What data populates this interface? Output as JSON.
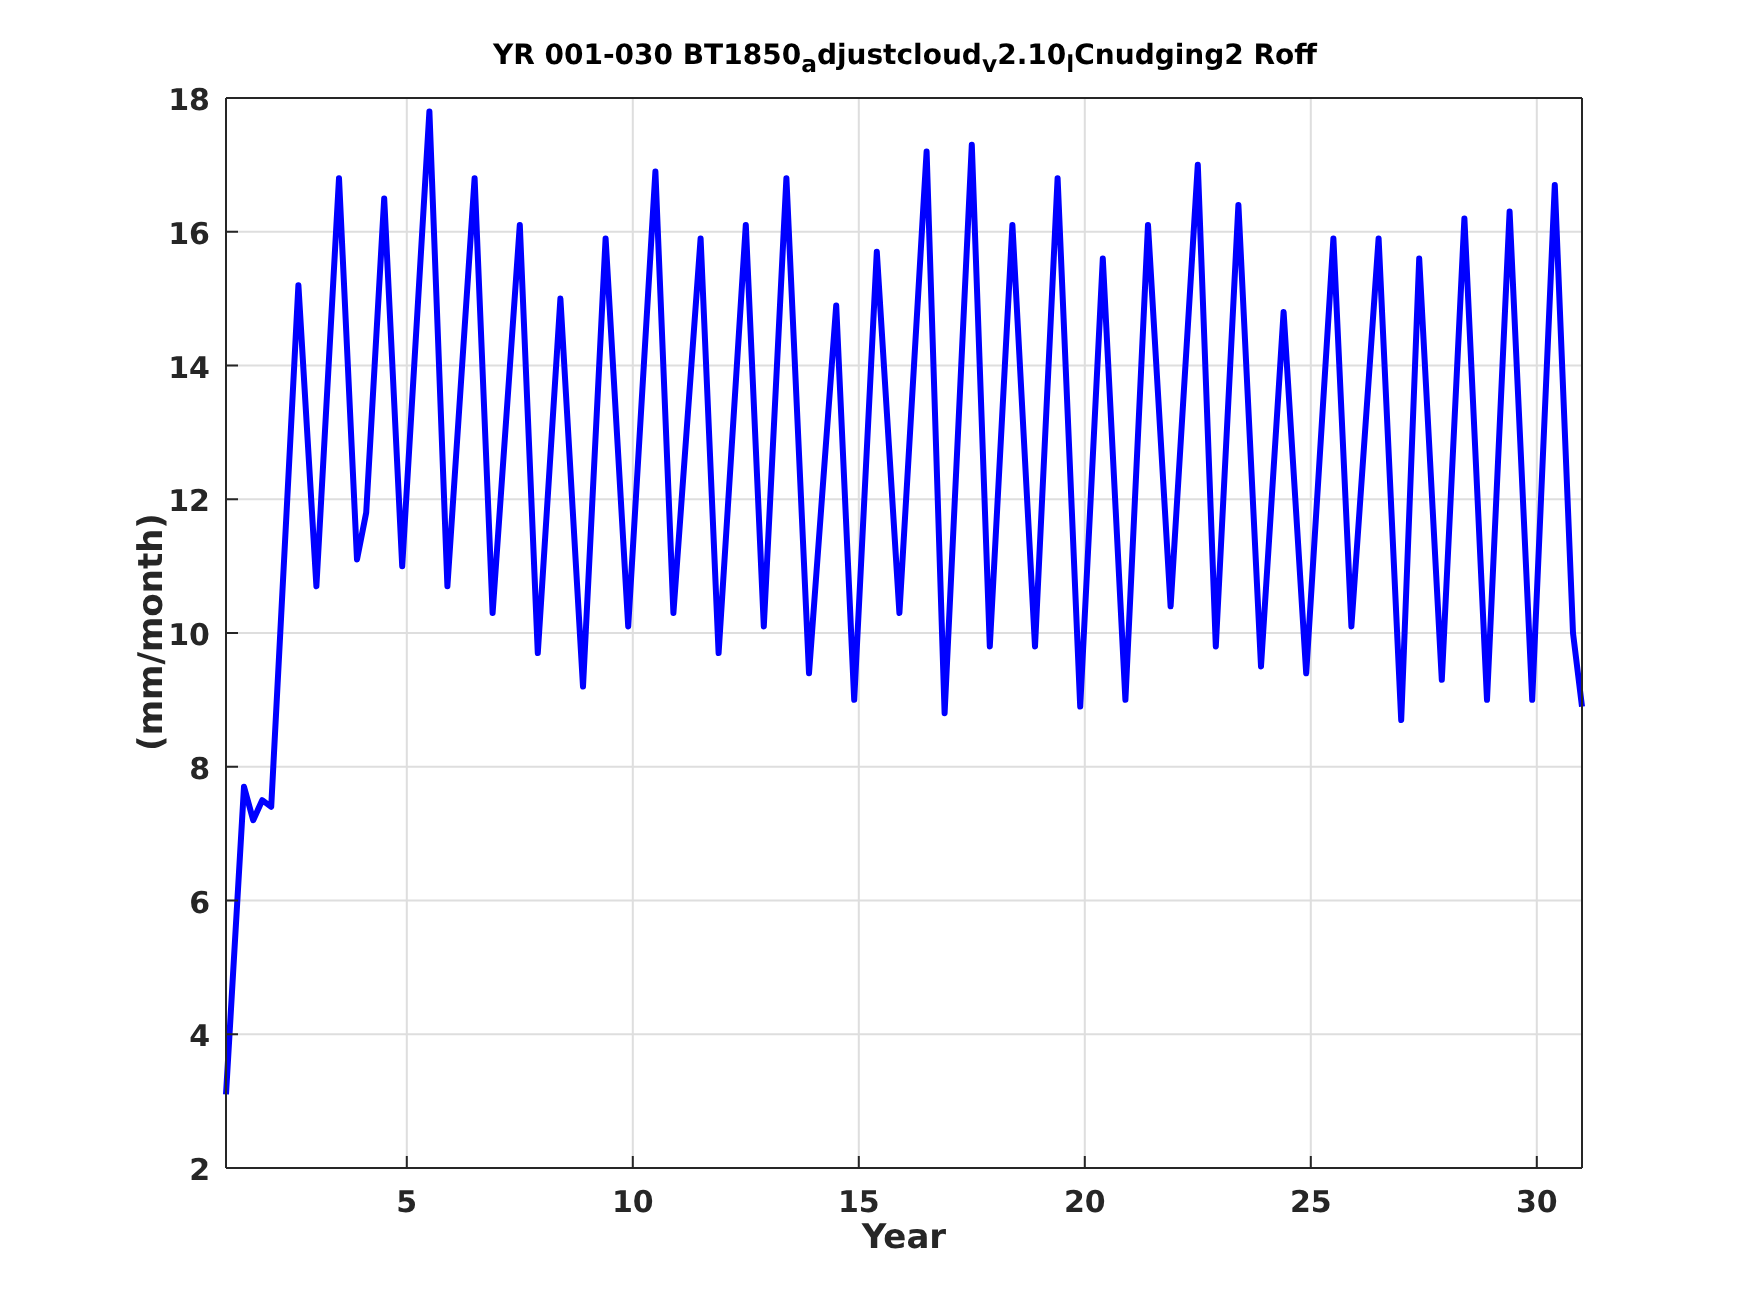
{
  "figure": {
    "chart_data": {
      "type": "line",
      "grid": true,
      "title": "YR 001-030 BT1850$_{a}$djustcloud$_{v}$2.10$_{l}$Cnudging2 Roff",
      "xlabel": "Year",
      "ylabel": "(mm/month)",
      "xlim": [
        1,
        31
      ],
      "ylim": [
        2,
        18
      ],
      "xticks": [
        5,
        10,
        15,
        20,
        25,
        30
      ],
      "yticks": [
        2,
        4,
        6,
        8,
        10,
        12,
        14,
        16,
        18
      ],
      "x": [
        1.0,
        1.4,
        1.6,
        1.8,
        2.0,
        2.6,
        3.0,
        3.5,
        3.9,
        4.1,
        4.5,
        4.9,
        5.5,
        5.9,
        6.5,
        6.9,
        7.5,
        7.9,
        8.4,
        8.9,
        9.4,
        9.9,
        10.5,
        10.9,
        11.5,
        11.9,
        12.5,
        12.9,
        13.4,
        13.9,
        14.5,
        14.9,
        15.4,
        15.9,
        16.5,
        16.9,
        17.5,
        17.9,
        18.4,
        18.9,
        19.4,
        19.9,
        20.4,
        20.9,
        21.4,
        21.9,
        22.5,
        22.9,
        23.4,
        23.9,
        24.4,
        24.9,
        25.5,
        25.9,
        26.5,
        27.0,
        27.4,
        27.9,
        28.4,
        28.9,
        29.4,
        29.9,
        30.4,
        30.8,
        31.0
      ],
      "series": [
        {
          "color": "#0000ff",
          "values": [
            3.1,
            7.7,
            7.2,
            7.5,
            7.4,
            15.2,
            10.7,
            16.8,
            11.1,
            11.8,
            16.5,
            11.0,
            17.8,
            10.7,
            16.8,
            10.3,
            16.1,
            9.7,
            15.0,
            9.2,
            15.9,
            10.1,
            16.9,
            10.3,
            15.9,
            9.7,
            16.1,
            10.1,
            16.8,
            9.4,
            14.9,
            9.0,
            15.7,
            10.3,
            17.2,
            8.8,
            17.3,
            9.8,
            16.1,
            9.8,
            16.8,
            8.9,
            15.6,
            9.0,
            16.1,
            10.4,
            17.0,
            9.8,
            16.4,
            9.5,
            14.8,
            9.4,
            15.9,
            10.1,
            15.9,
            8.7,
            15.6,
            9.3,
            16.2,
            9.0,
            16.3,
            9.0,
            16.7,
            10.0,
            8.9
          ]
        }
      ]
    }
  }
}
